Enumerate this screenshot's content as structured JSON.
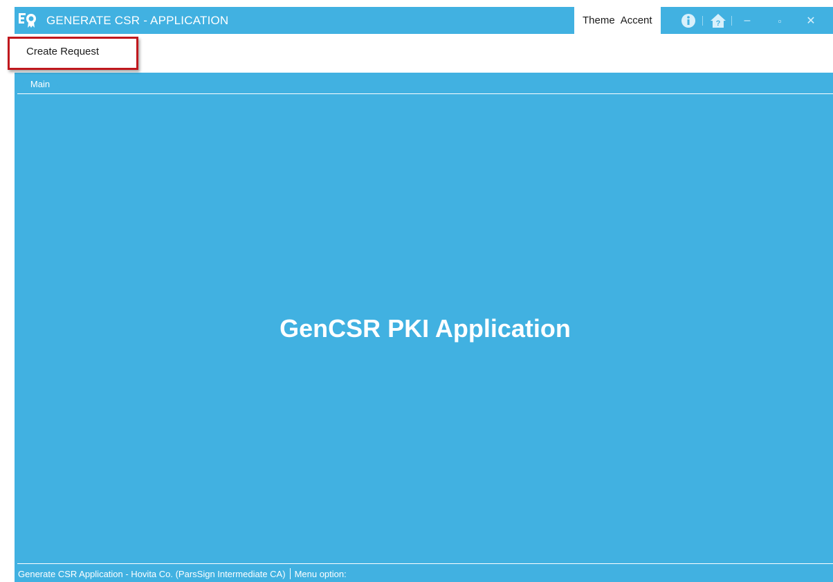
{
  "window": {
    "title": "GENERATE CSR - APPLICATION",
    "title_menu": [
      "Theme",
      "Accent"
    ],
    "accent_color": "#41b1e1",
    "icons": {
      "app": "certificate-app-icon",
      "info": "info-icon",
      "help": "home-help-icon",
      "minimize": "minimize-icon",
      "maximize": "maximize-icon",
      "close": "close-icon"
    },
    "control_glyphs": {
      "minimize": "–",
      "maximize": "▫",
      "close": "✕"
    }
  },
  "menubar": {
    "items": [
      "Create Request"
    ]
  },
  "tabs": [
    {
      "label": "Main",
      "active": true
    }
  ],
  "main": {
    "heading": "GenCSR PKI Application"
  },
  "statusbar": {
    "left": "Generate CSR Application - Hovita Co. (ParsSign Intermediate CA)",
    "right": "Menu option:"
  },
  "annotation": {
    "highlight_color": "#c0171d",
    "highlighted_item": "Create Request"
  }
}
